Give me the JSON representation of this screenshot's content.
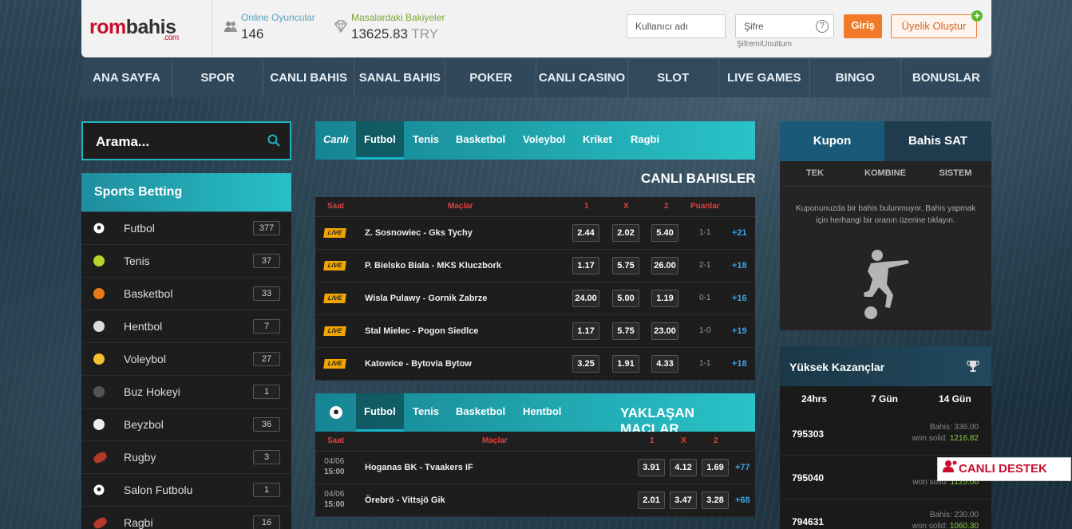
{
  "header": {
    "logo": {
      "part1": "rom",
      "part2": "bahis",
      "suffix": ".com"
    },
    "online_label": "Online Oyuncular",
    "online_count": "146",
    "balance_label": "Masalardaki Bakiyeler",
    "balance_value": "13625.83",
    "balance_currency": "TRY",
    "username_placeholder": "Kullanıcı adı",
    "password_placeholder": "Şifre",
    "help_symbol": "?",
    "forgot_link": "ŞifremiUnuttum",
    "login_button": "Giriş",
    "register_button": "Üyelik Oluştur",
    "plus_symbol": "+"
  },
  "nav": [
    "ANA SAYFA",
    "SPOR",
    "CANLI BAHIS",
    "SANAL BAHIS",
    "POKER",
    "CANLI CASINO",
    "SLOT",
    "LIVE GAMES",
    "BINGO",
    "BONUSLAR"
  ],
  "sidebar": {
    "search_placeholder": "Arama...",
    "title": "Sports Betting",
    "items": [
      {
        "label": "Futbol",
        "count": "377",
        "icon": "soccer-ball-icon",
        "color": "#ffffff"
      },
      {
        "label": "Tenis",
        "count": "37",
        "icon": "tennis-ball-icon",
        "color": "#b7d42b"
      },
      {
        "label": "Basketbol",
        "count": "33",
        "icon": "basketball-icon",
        "color": "#e87a1c"
      },
      {
        "label": "Hentbol",
        "count": "7",
        "icon": "handball-icon",
        "color": "#dddddd"
      },
      {
        "label": "Voleybol",
        "count": "27",
        "icon": "volleyball-icon",
        "color": "#f2c12e"
      },
      {
        "label": "Buz Hokeyi",
        "count": "1",
        "icon": "hockey-puck-icon",
        "color": "#555555"
      },
      {
        "label": "Beyzbol",
        "count": "36",
        "icon": "baseball-icon",
        "color": "#eeeeee"
      },
      {
        "label": "Rugby",
        "count": "3",
        "icon": "rugby-ball-icon",
        "color": "#b13a2a"
      },
      {
        "label": "Salon Futbolu",
        "count": "1",
        "icon": "futsal-ball-icon",
        "color": "#ffffff"
      },
      {
        "label": "Ragbi",
        "count": "16",
        "icon": "rugby-ball-icon",
        "color": "#b13a2a"
      }
    ]
  },
  "live": {
    "tabs": [
      "Canlı",
      "Futbol",
      "Tenis",
      "Basketbol",
      "Voleybol",
      "Kriket",
      "Ragbi"
    ],
    "active_tab": "Futbol",
    "title": "CANLI BAHISLER",
    "columns": {
      "time": "Saat",
      "match": "Maçlar",
      "one": "1",
      "draw": "X",
      "two": "2",
      "score": "Puanlar"
    },
    "badge": "LIVE",
    "rows": [
      {
        "match": "Z. Sosnowiec - Gks Tychy",
        "o1": "2.44",
        "ox": "2.02",
        "o2": "5.40",
        "score": "1-1",
        "more": "+21"
      },
      {
        "match": "P. Bielsko Biala - MKS Kluczbork",
        "o1": "1.17",
        "ox": "5.75",
        "o2": "26.00",
        "score": "2-1",
        "more": "+18"
      },
      {
        "match": "Wisla Pulawy - Gornik Zabrze",
        "o1": "24.00",
        "ox": "5.00",
        "o2": "1.19",
        "score": "0-1",
        "more": "+16"
      },
      {
        "match": "Stal Mielec - Pogon Siedlce",
        "o1": "1.17",
        "ox": "5.75",
        "o2": "23.00",
        "score": "1-0",
        "more": "+19"
      },
      {
        "match": "Katowice - Bytovia Bytow",
        "o1": "3.25",
        "ox": "1.91",
        "o2": "4.33",
        "score": "1-1",
        "more": "+18"
      }
    ]
  },
  "upcoming": {
    "tabs": [
      "Futbol",
      "Tenis",
      "Basketbol",
      "Hentbol"
    ],
    "active_tab": "Futbol",
    "title": "YAKLAŞAN MAÇLAR",
    "columns": {
      "time": "Saat",
      "match": "Maçlar",
      "one": "1",
      "draw": "X",
      "two": "2"
    },
    "rows": [
      {
        "date": "04/06",
        "time": "15:00",
        "match": "Hoganas BK - Tvaakers IF",
        "o1": "3.91",
        "ox": "4.12",
        "o2": "1.69",
        "more": "+77"
      },
      {
        "date": "04/06",
        "time": "15:00",
        "match": "Örebrö - Vittsjö Gik",
        "o1": "2.01",
        "ox": "3.47",
        "o2": "3.28",
        "more": "+68"
      }
    ]
  },
  "kupon": {
    "tab_active": "Kupon",
    "tab_other": "Bahis SAT",
    "subtabs": [
      "TEK",
      "KOMBINE",
      "SISTEM"
    ],
    "empty_message": "Kuponunuzda bir bahis bulunmuyor. Bahis yapmak için herhangi bir oranın üzerine tıklayın."
  },
  "winnings": {
    "title": "Yüksek Kazançlar",
    "tabs": [
      "24hrs",
      "7 Gün",
      "14 Gün"
    ],
    "bet_label": "Bahis:",
    "won_label": "won solid:",
    "rows": [
      {
        "id": "795303",
        "bet": "336.00",
        "won": "1216.82"
      },
      {
        "id": "795040",
        "bet": "",
        "won": "1125.00"
      },
      {
        "id": "794631",
        "bet": "230.00",
        "won": "1060.30"
      }
    ]
  },
  "support": {
    "label": "CANLI DESTEK"
  },
  "colors": {
    "accent": "#1fb5c0",
    "orange": "#f07a2a",
    "odds_positive": "#3aa6e8",
    "won": "#8ccf3f",
    "header_red": "#e04040"
  }
}
